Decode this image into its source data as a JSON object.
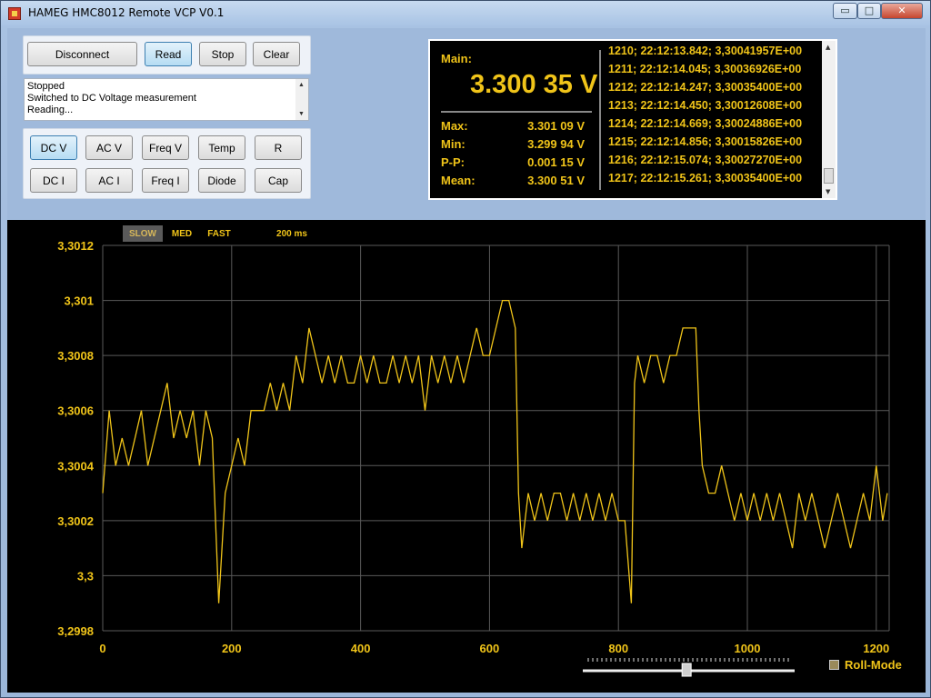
{
  "window": {
    "title": "HAMEG HMC8012 Remote VCP V0.1",
    "controls": {
      "minimize": "▭",
      "maximize": "□",
      "close": "✕"
    }
  },
  "toolbar": {
    "disconnect": "Disconnect",
    "read": "Read",
    "stop": "Stop",
    "clear": "Clear"
  },
  "status_log": [
    "Stopped",
    "Switched to DC Voltage measurement",
    "Reading..."
  ],
  "modes": {
    "row1": [
      "DC V",
      "AC V",
      "Freq V",
      "Temp",
      "R"
    ],
    "row2": [
      "DC I",
      "AC I",
      "Freq I",
      "Diode",
      "Cap"
    ],
    "selected": "DC V"
  },
  "meter": {
    "main_label": "Main:",
    "main_value": "3.300 35 V",
    "stats": [
      {
        "label": "Max:",
        "value": "3.301 09 V"
      },
      {
        "label": "Min:",
        "value": "3.299 94 V"
      },
      {
        "label": "P-P:",
        "value": "0.001 15 V"
      },
      {
        "label": "Mean:",
        "value": "3.300 51 V"
      }
    ],
    "log": [
      "1210; 22:12:13.842; 3,30041957E+00",
      "1211; 22:12:14.045; 3,30036926E+00",
      "1212; 22:12:14.247; 3,30035400E+00",
      "1213; 22:12:14.450; 3,30012608E+00",
      "1214; 22:12:14.669; 3,30024886E+00",
      "1215; 22:12:14.856; 3,30015826E+00",
      "1216; 22:12:15.074; 3,30027270E+00",
      "1217; 22:12:15.261; 3,30035400E+00"
    ]
  },
  "speed": {
    "options": [
      "SLOW",
      "MED",
      "FAST"
    ],
    "selected": "SLOW",
    "interval": "200 ms"
  },
  "roll_mode": {
    "label": "Roll-Mode",
    "checked": true
  },
  "slider": {
    "value": 0.49
  },
  "colors": {
    "trace": "#f0c419",
    "grid": "#5a5a5a",
    "plot_bg": "#000000"
  },
  "chart_data": {
    "type": "line",
    "title": "",
    "xlabel": "",
    "ylabel": "",
    "xlim": [
      0,
      1220
    ],
    "ylim": [
      3.2998,
      3.3012
    ],
    "x_ticks": [
      0,
      200,
      400,
      600,
      800,
      1000,
      1200
    ],
    "x_tick_labels": [
      "0",
      "200",
      "400",
      "600",
      "800",
      "1000",
      "1200"
    ],
    "y_ticks": [
      3.2998,
      3.3,
      3.3002,
      3.3004,
      3.3006,
      3.3008,
      3.301,
      3.3012
    ],
    "y_tick_labels": [
      "3,2998",
      "3,3",
      "3,3002",
      "3,3004",
      "3,3006",
      "3,3008",
      "3,301",
      "3,3012"
    ],
    "grid": true,
    "series": [
      {
        "x": [
          0,
          10,
          20,
          30,
          40,
          50,
          60,
          70,
          80,
          90,
          100,
          110,
          120,
          130,
          140,
          150,
          160,
          170,
          180,
          190,
          200,
          210,
          220,
          230,
          240,
          250,
          260,
          270,
          280,
          290,
          300,
          310,
          320,
          330,
          340,
          350,
          360,
          370,
          380,
          390,
          400,
          410,
          420,
          430,
          440,
          450,
          460,
          470,
          480,
          490,
          500,
          510,
          520,
          530,
          540,
          550,
          560,
          570,
          580,
          590,
          600,
          610,
          620,
          630,
          640,
          645,
          650,
          660,
          670,
          680,
          690,
          700,
          710,
          720,
          730,
          740,
          750,
          760,
          770,
          780,
          790,
          800,
          810,
          820,
          825,
          830,
          840,
          850,
          860,
          870,
          880,
          890,
          900,
          910,
          920,
          925,
          930,
          940,
          950,
          960,
          970,
          980,
          990,
          1000,
          1010,
          1020,
          1030,
          1040,
          1050,
          1060,
          1070,
          1080,
          1090,
          1100,
          1110,
          1120,
          1130,
          1140,
          1150,
          1160,
          1170,
          1180,
          1190,
          1200,
          1210,
          1217
        ],
        "y": [
          3.3003,
          3.3006,
          3.3004,
          3.3005,
          3.3004,
          3.3005,
          3.3006,
          3.3004,
          3.3005,
          3.3006,
          3.3007,
          3.3005,
          3.3006,
          3.3005,
          3.3006,
          3.3004,
          3.3006,
          3.3005,
          3.2999,
          3.3003,
          3.3004,
          3.3005,
          3.3004,
          3.3006,
          3.3006,
          3.3006,
          3.3007,
          3.3006,
          3.3007,
          3.3006,
          3.3008,
          3.3007,
          3.3009,
          3.3008,
          3.3007,
          3.3008,
          3.3007,
          3.3008,
          3.3007,
          3.3007,
          3.3008,
          3.3007,
          3.3008,
          3.3007,
          3.3007,
          3.3008,
          3.3007,
          3.3008,
          3.3007,
          3.3008,
          3.3006,
          3.3008,
          3.3007,
          3.3008,
          3.3007,
          3.3008,
          3.3007,
          3.3008,
          3.3009,
          3.3008,
          3.3008,
          3.3009,
          3.301,
          3.301,
          3.3009,
          3.3003,
          3.3001,
          3.3003,
          3.3002,
          3.3003,
          3.3002,
          3.3003,
          3.3003,
          3.3002,
          3.3003,
          3.3002,
          3.3003,
          3.3002,
          3.3003,
          3.3002,
          3.3003,
          3.3002,
          3.3002,
          3.2999,
          3.3007,
          3.3008,
          3.3007,
          3.3008,
          3.3008,
          3.3007,
          3.3008,
          3.3008,
          3.3009,
          3.3009,
          3.3009,
          3.3006,
          3.3004,
          3.3003,
          3.3003,
          3.3004,
          3.3003,
          3.3002,
          3.3003,
          3.3002,
          3.3003,
          3.3002,
          3.3003,
          3.3002,
          3.3003,
          3.3002,
          3.3001,
          3.3003,
          3.3002,
          3.3003,
          3.3002,
          3.3001,
          3.3002,
          3.3003,
          3.3002,
          3.3001,
          3.3002,
          3.3003,
          3.3002,
          3.3004,
          3.3002,
          3.3003
        ]
      }
    ]
  }
}
